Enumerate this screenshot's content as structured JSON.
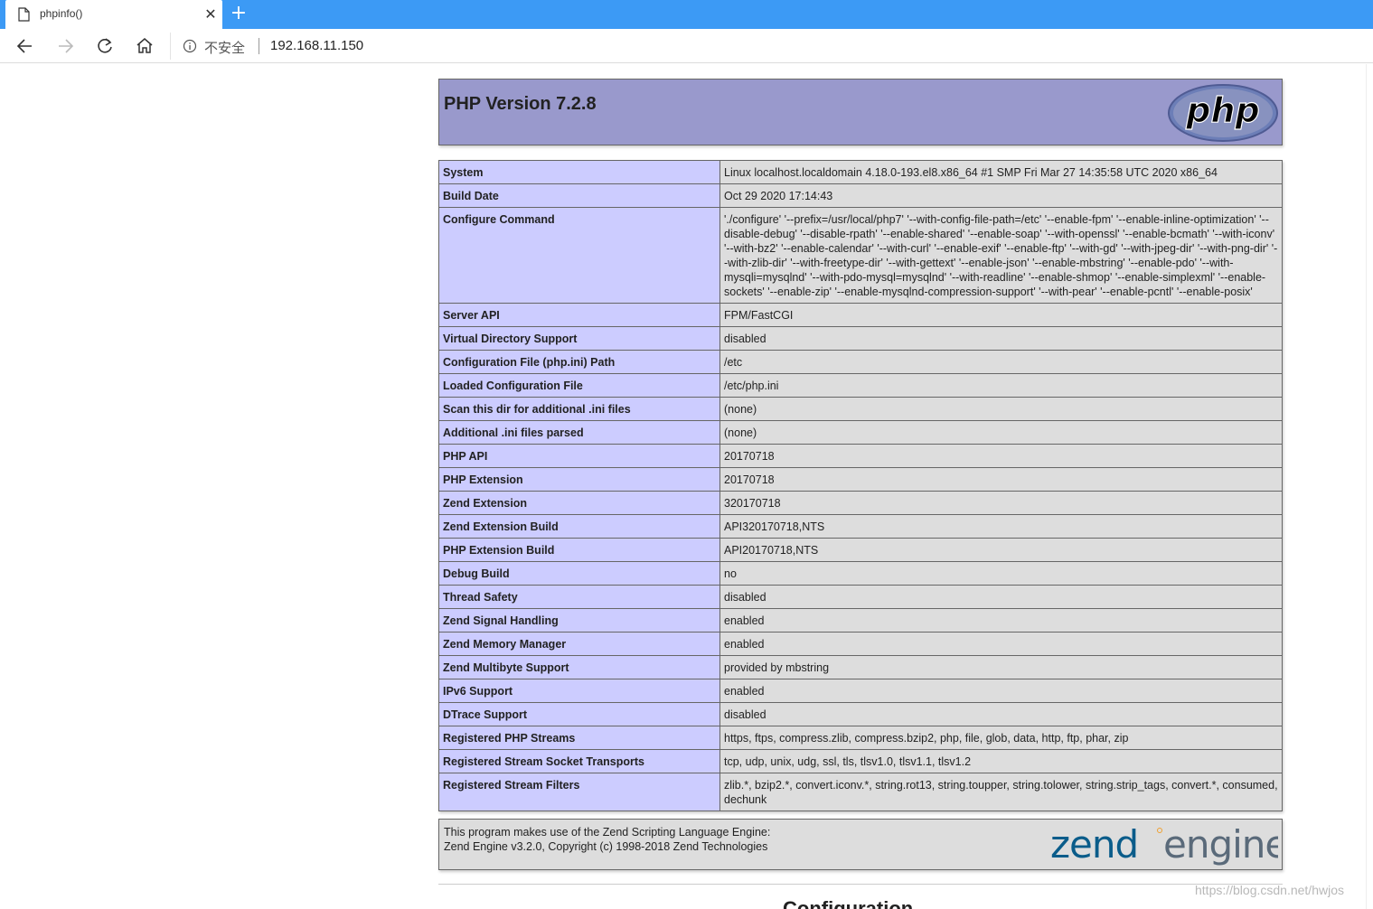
{
  "browser": {
    "tab_title": "phpinfo()",
    "tab_close": "✕",
    "new_tab": "+",
    "security_label": "不安全",
    "url": "192.168.11.150"
  },
  "header": {
    "version": "PHP Version 7.2.8",
    "logo_text": "php"
  },
  "info_rows": [
    {
      "key": "System",
      "value": "Linux localhost.localdomain 4.18.0-193.el8.x86_64 #1 SMP Fri Mar 27 14:35:58 UTC 2020 x86_64"
    },
    {
      "key": "Build Date",
      "value": "Oct 29 2020 17:14:43"
    },
    {
      "key": "Configure Command",
      "value": "'./configure' '--prefix=/usr/local/php7' '--with-config-file-path=/etc' '--enable-fpm' '--enable-inline-optimization' '--disable-debug' '--disable-rpath' '--enable-shared' '--enable-soap' '--with-openssl' '--enable-bcmath' '--with-iconv' '--with-bz2' '--enable-calendar' '--with-curl' '--enable-exif' '--enable-ftp' '--with-gd' '--with-jpeg-dir' '--with-png-dir' '--with-zlib-dir' '--with-freetype-dir' '--with-gettext' '--enable-json' '--enable-mbstring' '--enable-pdo' '--with-mysqli=mysqlnd' '--with-pdo-mysql=mysqlnd' '--with-readline' '--enable-shmop' '--enable-simplexml' '--enable-sockets' '--enable-zip' '--enable-mysqlnd-compression-support' '--with-pear' '--enable-pcntl' '--enable-posix'"
    },
    {
      "key": "Server API",
      "value": "FPM/FastCGI"
    },
    {
      "key": "Virtual Directory Support",
      "value": "disabled"
    },
    {
      "key": "Configuration File (php.ini) Path",
      "value": "/etc"
    },
    {
      "key": "Loaded Configuration File",
      "value": "/etc/php.ini"
    },
    {
      "key": "Scan this dir for additional .ini files",
      "value": "(none)"
    },
    {
      "key": "Additional .ini files parsed",
      "value": "(none)"
    },
    {
      "key": "PHP API",
      "value": "20170718"
    },
    {
      "key": "PHP Extension",
      "value": "20170718"
    },
    {
      "key": "Zend Extension",
      "value": "320170718"
    },
    {
      "key": "Zend Extension Build",
      "value": "API320170718,NTS"
    },
    {
      "key": "PHP Extension Build",
      "value": "API20170718,NTS"
    },
    {
      "key": "Debug Build",
      "value": "no"
    },
    {
      "key": "Thread Safety",
      "value": "disabled"
    },
    {
      "key": "Zend Signal Handling",
      "value": "enabled"
    },
    {
      "key": "Zend Memory Manager",
      "value": "enabled"
    },
    {
      "key": "Zend Multibyte Support",
      "value": "provided by mbstring"
    },
    {
      "key": "IPv6 Support",
      "value": "enabled"
    },
    {
      "key": "DTrace Support",
      "value": "disabled"
    },
    {
      "key": "Registered PHP Streams",
      "value": "https, ftps, compress.zlib, compress.bzip2, php, file, glob, data, http, ftp, phar, zip"
    },
    {
      "key": "Registered Stream Socket Transports",
      "value": "tcp, udp, unix, udg, ssl, tls, tlsv1.0, tlsv1.1, tlsv1.2"
    },
    {
      "key": "Registered Stream Filters",
      "value": "zlib.*, bzip2.*, convert.iconv.*, string.rot13, string.toupper, string.tolower, string.strip_tags, convert.*, consumed, dechunk"
    }
  ],
  "zend": {
    "line1": "This program makes use of the Zend Scripting Language Engine:",
    "line2": "Zend Engine v3.2.0, Copyright (c) 1998-2018 Zend Technologies",
    "logo_word1": "zend",
    "logo_word2": "engine"
  },
  "next_section": "Configuration",
  "watermark": "https://blog.csdn.net/hwjos"
}
